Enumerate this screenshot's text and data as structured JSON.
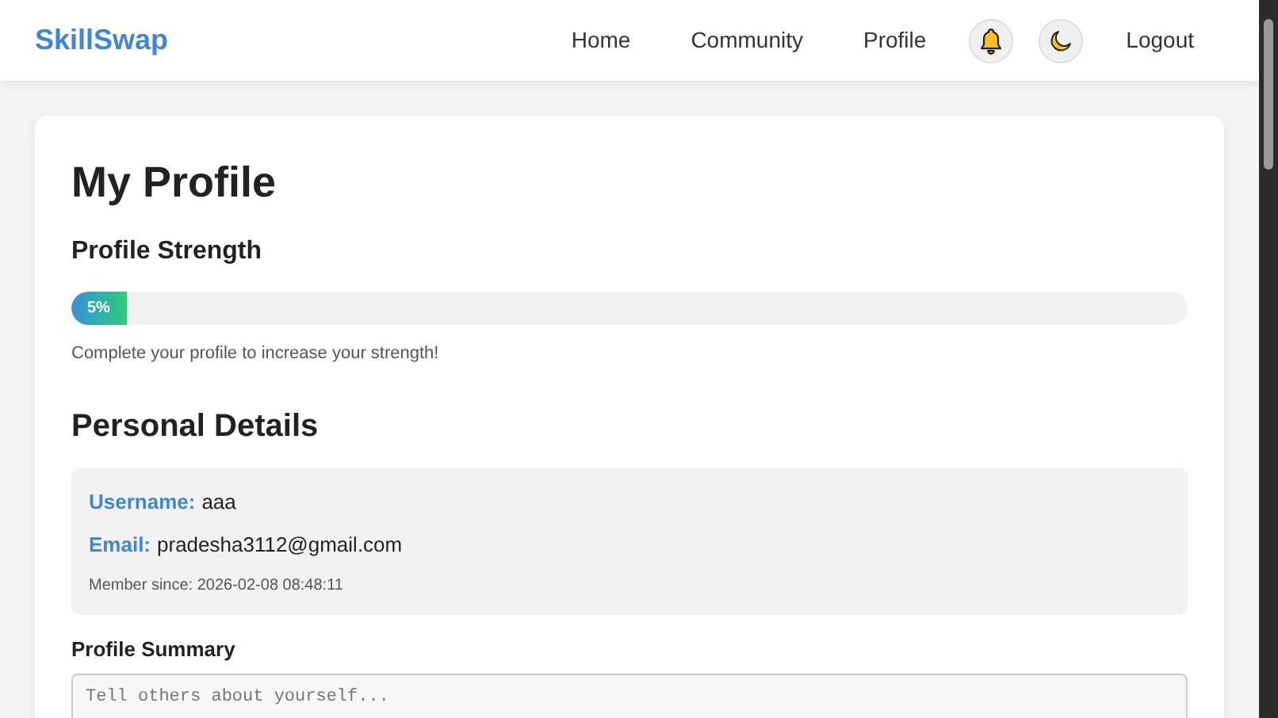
{
  "brand": "SkillSwap",
  "nav": [
    {
      "label": "Home",
      "kind": "link"
    },
    {
      "label": "Community",
      "kind": "link"
    },
    {
      "label": "Profile",
      "kind": "link"
    },
    {
      "kind": "bell"
    },
    {
      "kind": "moon"
    },
    {
      "label": "Logout",
      "kind": "link"
    }
  ],
  "title": "My Profile",
  "strength": {
    "heading": "Profile Strength",
    "level": 0.05,
    "reading": "5%",
    "hint": "Complete your profile to increase your strength!"
  },
  "personal": {
    "heading": "Personal Details",
    "fields": [
      {
        "label": "Username:",
        "value": "aaa"
      },
      {
        "label": "Email:",
        "value": "pradesha3112@gmail.com"
      }
    ],
    "member_since": "Member since: 2026-02-08 08:48:11"
  },
  "summary": {
    "label": "Profile Summary",
    "placeholder": "Tell others about yourself..."
  }
}
